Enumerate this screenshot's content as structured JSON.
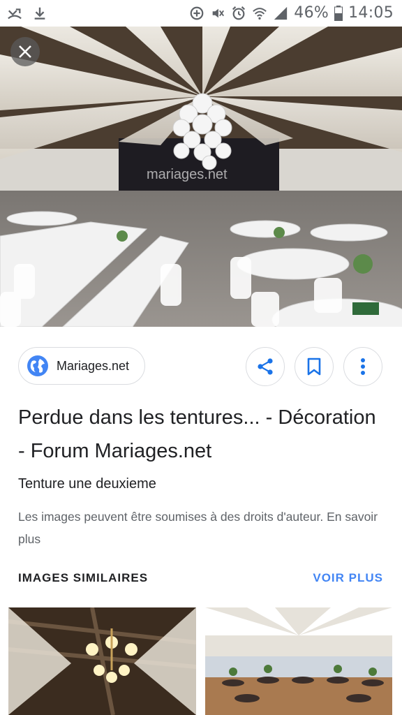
{
  "status_bar": {
    "battery": "46%",
    "time": "14:05",
    "icons": [
      "missed-call-icon",
      "download-icon",
      "data-saver-icon",
      "mute-icon",
      "alarm-icon",
      "wifi-icon",
      "signal-icon",
      "battery-icon"
    ]
  },
  "hero": {
    "watermark": "mariages.net",
    "close_icon": "close-icon"
  },
  "source": {
    "site_name": "Mariages.net",
    "icon": "globe-icon"
  },
  "actions": {
    "share_icon": "share-icon",
    "bookmark_icon": "bookmark-icon",
    "more_icon": "more-vert-icon"
  },
  "result": {
    "title": "Perdue dans les tentures... - Décoration - Forum Mariages.net",
    "subtitle": "Tenture une deuxieme",
    "copyright_notice": "Les images peuvent être soumises à des droits d'auteur.",
    "learn_more": "En savoir plus"
  },
  "similar": {
    "heading": "IMAGES SIMILAIRES",
    "see_more": "VOIR PLUS"
  },
  "colors": {
    "accent": "#4285f4",
    "text_primary": "#202124",
    "text_secondary": "#5f6368",
    "border": "#dadce0"
  }
}
